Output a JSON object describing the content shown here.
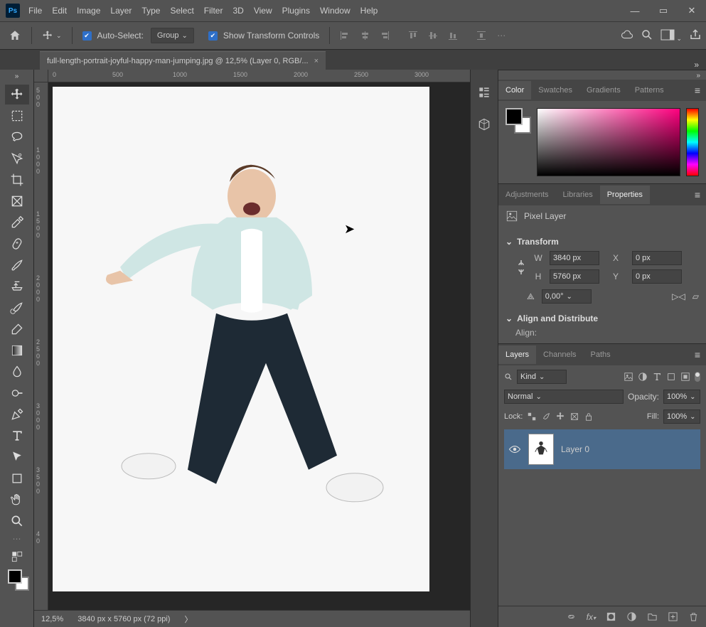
{
  "app": {
    "logo": "Ps"
  },
  "menu": [
    "File",
    "Edit",
    "Image",
    "Layer",
    "Type",
    "Select",
    "Filter",
    "3D",
    "View",
    "Plugins",
    "Window",
    "Help"
  ],
  "options": {
    "auto_select_label": "Auto-Select:",
    "auto_select_value": "Group",
    "show_transform_label": "Show Transform Controls"
  },
  "document": {
    "tab_title": "full-length-portrait-joyful-happy-man-jumping.jpg @ 12,5% (Layer 0, RGB/...",
    "ruler_h": [
      "0",
      "500",
      "1000",
      "1500",
      "2000",
      "2500",
      "3000"
    ],
    "ruler_v": [
      "5\n0\n0",
      "1\n0\n0\n0",
      "1\n5\n0\n0",
      "2\n0\n0\n0",
      "2\n5\n0\n0",
      "3\n0\n0\n0",
      "3\n5\n0\n0",
      "4\n0"
    ],
    "status_zoom": "12,5%",
    "status_info": "3840 px x 5760 px (72 ppi)"
  },
  "panel_color": {
    "tabs": [
      "Color",
      "Swatches",
      "Gradients",
      "Patterns"
    ],
    "active": 0
  },
  "panel_props": {
    "tabs": [
      "Adjustments",
      "Libraries",
      "Properties"
    ],
    "active": 2,
    "pixel_layer_label": "Pixel Layer",
    "transform_title": "Transform",
    "W_label": "W",
    "W_value": "3840 px",
    "H_label": "H",
    "H_value": "5760 px",
    "X_label": "X",
    "X_value": "0 px",
    "Y_label": "Y",
    "Y_value": "0 px",
    "angle_value": "0,00°",
    "align_title": "Align and Distribute",
    "align_label": "Align:"
  },
  "panel_layers": {
    "tabs": [
      "Layers",
      "Channels",
      "Paths"
    ],
    "active": 0,
    "filter_kind": "Kind",
    "blend_mode": "Normal",
    "opacity_label": "Opacity:",
    "opacity_value": "100%",
    "lock_label": "Lock:",
    "fill_label": "Fill:",
    "fill_value": "100%",
    "layer_name": "Layer 0"
  }
}
